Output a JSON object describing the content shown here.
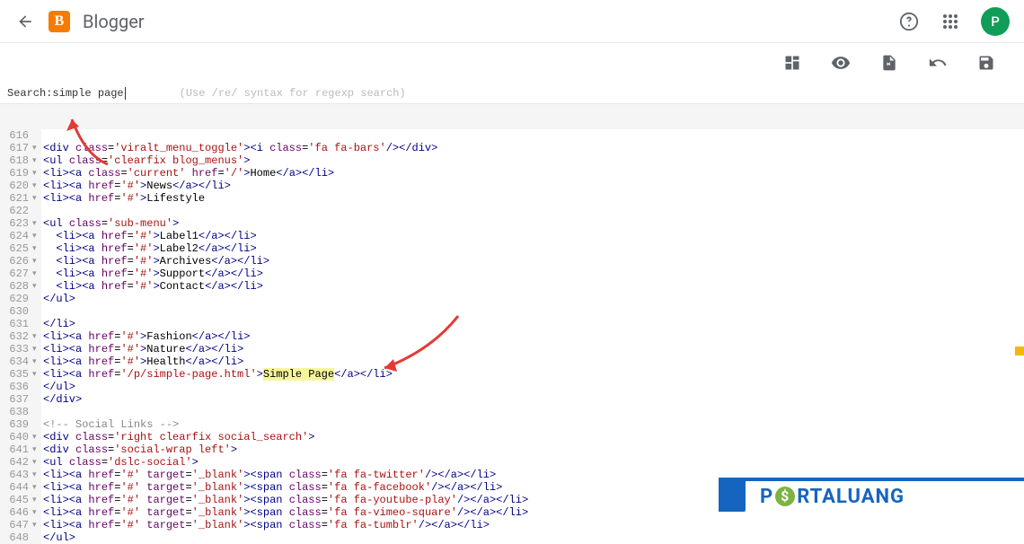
{
  "header": {
    "app_title": "Blogger",
    "logo_letter": "B",
    "avatar_letter": "P"
  },
  "search": {
    "label": "Search: ",
    "value": "simple page",
    "hint": "(Use /re/ syntax for regexp search)"
  },
  "lines": [
    {
      "n": "616",
      "f": "",
      "html": ""
    },
    {
      "n": "617",
      "f": "▾",
      "html": "<span class='t-tag'>&lt;div</span> <span class='t-attr'>class</span>=<span class='t-val'>'viralt_menu_toggle'</span><span class='t-tag'>&gt;&lt;i</span> <span class='t-attr'>class</span>=<span class='t-val'>'fa fa-bars'</span><span class='t-tag'>/&gt;&lt;/div&gt;</span>"
    },
    {
      "n": "618",
      "f": "▾",
      "html": "<span class='t-tag'>&lt;ul</span> <span class='t-attr'>class</span>=<span class='t-val'>'clearfix blog_menus'</span><span class='t-tag'>&gt;</span>"
    },
    {
      "n": "619",
      "f": "▾",
      "html": "<span class='t-tag'>&lt;li&gt;&lt;a</span> <span class='t-attr'>class</span>=<span class='t-val'>'current'</span> <span class='t-attr'>href</span>=<span class='t-val'>'/'</span><span class='t-tag'>&gt;</span><span class='t-text'>Home</span><span class='t-tag'>&lt;/a&gt;&lt;/li&gt;</span>"
    },
    {
      "n": "620",
      "f": "▾",
      "html": "<span class='t-tag'>&lt;li&gt;&lt;a</span> <span class='t-attr'>href</span>=<span class='t-val'>'#'</span><span class='t-tag'>&gt;</span><span class='t-text'>News</span><span class='t-tag'>&lt;/a&gt;&lt;/li&gt;</span>"
    },
    {
      "n": "621",
      "f": "▾",
      "html": "<span class='t-tag'>&lt;li&gt;&lt;a</span> <span class='t-attr'>href</span>=<span class='t-val'>'#'</span><span class='t-tag'>&gt;</span><span class='t-text'>Lifestyle</span>"
    },
    {
      "n": "622",
      "f": "",
      "html": ""
    },
    {
      "n": "623",
      "f": "▾",
      "html": "<span class='t-tag'>&lt;ul</span> <span class='t-attr'>class</span>=<span class='t-val'>'sub-menu'</span><span class='t-tag'>&gt;</span>"
    },
    {
      "n": "624",
      "f": "▾",
      "html": "  <span class='t-tag'>&lt;li&gt;&lt;a</span> <span class='t-attr'>href</span>=<span class='t-val'>'#'</span><span class='t-tag'>&gt;</span><span class='t-text'>Label1</span><span class='t-tag'>&lt;/a&gt;&lt;/li&gt;</span>"
    },
    {
      "n": "625",
      "f": "▾",
      "html": "  <span class='t-tag'>&lt;li&gt;&lt;a</span> <span class='t-attr'>href</span>=<span class='t-val'>'#'</span><span class='t-tag'>&gt;</span><span class='t-text'>Label2</span><span class='t-tag'>&lt;/a&gt;&lt;/li&gt;</span>"
    },
    {
      "n": "626",
      "f": "▾",
      "html": "  <span class='t-tag'>&lt;li&gt;&lt;a</span> <span class='t-attr'>href</span>=<span class='t-val'>'#'</span><span class='t-tag'>&gt;</span><span class='t-text'>Archives</span><span class='t-tag'>&lt;/a&gt;&lt;/li&gt;</span>"
    },
    {
      "n": "627",
      "f": "▾",
      "html": "  <span class='t-tag'>&lt;li&gt;&lt;a</span> <span class='t-attr'>href</span>=<span class='t-val'>'#'</span><span class='t-tag'>&gt;</span><span class='t-text'>Support</span><span class='t-tag'>&lt;/a&gt;&lt;/li&gt;</span>"
    },
    {
      "n": "628",
      "f": "▾",
      "html": "  <span class='t-tag'>&lt;li&gt;&lt;a</span> <span class='t-attr'>href</span>=<span class='t-val'>'#'</span><span class='t-tag'>&gt;</span><span class='t-text'>Contact</span><span class='t-tag'>&lt;/a&gt;&lt;/li&gt;</span>"
    },
    {
      "n": "629",
      "f": "",
      "html": "<span class='t-tag'>&lt;/ul&gt;</span>"
    },
    {
      "n": "630",
      "f": "",
      "html": ""
    },
    {
      "n": "631",
      "f": "",
      "html": "<span class='t-tag'>&lt;/li&gt;</span>"
    },
    {
      "n": "632",
      "f": "▾",
      "html": "<span class='t-tag'>&lt;li&gt;&lt;a</span> <span class='t-attr'>href</span>=<span class='t-val'>'#'</span><span class='t-tag'>&gt;</span><span class='t-text'>Fashion</span><span class='t-tag'>&lt;/a&gt;&lt;/li&gt;</span>"
    },
    {
      "n": "633",
      "f": "▾",
      "html": "<span class='t-tag'>&lt;li&gt;&lt;a</span> <span class='t-attr'>href</span>=<span class='t-val'>'#'</span><span class='t-tag'>&gt;</span><span class='t-text'>Nature</span><span class='t-tag'>&lt;/a&gt;&lt;/li&gt;</span>"
    },
    {
      "n": "634",
      "f": "▾",
      "html": "<span class='t-tag'>&lt;li&gt;&lt;a</span> <span class='t-attr'>href</span>=<span class='t-val'>'#'</span><span class='t-tag'>&gt;</span><span class='t-text'>Health</span><span class='t-tag'>&lt;/a&gt;&lt;/li&gt;</span>"
    },
    {
      "n": "635",
      "f": "▾",
      "html": "<span class='t-tag'>&lt;li&gt;&lt;a</span> <span class='t-attr'>href</span>=<span class='t-val'>'/p/simple-page.html'</span><span class='t-tag'>&gt;</span><span class='hl t-text'>Simple Page</span><span class='t-tag'>&lt;/a&gt;&lt;/li&gt;</span>"
    },
    {
      "n": "636",
      "f": "",
      "html": "<span class='t-tag'>&lt;/ul&gt;</span>"
    },
    {
      "n": "637",
      "f": "",
      "html": "<span class='t-tag'>&lt;/div&gt;</span>"
    },
    {
      "n": "638",
      "f": "",
      "html": ""
    },
    {
      "n": "639",
      "f": "",
      "html": "<span class='t-comment'>&lt;!-- Social Links --&gt;</span>"
    },
    {
      "n": "640",
      "f": "▾",
      "html": "<span class='t-tag'>&lt;div</span> <span class='t-attr'>class</span>=<span class='t-val'>'right clearfix social_search'</span><span class='t-tag'>&gt;</span>"
    },
    {
      "n": "641",
      "f": "▾",
      "html": "<span class='t-tag'>&lt;div</span> <span class='t-attr'>class</span>=<span class='t-val'>'social-wrap left'</span><span class='t-tag'>&gt;</span>"
    },
    {
      "n": "642",
      "f": "▾",
      "html": "<span class='t-tag'>&lt;ul</span> <span class='t-attr'>class</span>=<span class='t-val'>'dslc-social'</span><span class='t-tag'>&gt;</span>"
    },
    {
      "n": "643",
      "f": "▾",
      "html": "<span class='t-tag'>&lt;li&gt;&lt;a</span> <span class='t-attr'>href</span>=<span class='t-val'>'#'</span> <span class='t-attr'>target</span>=<span class='t-val'>'_blank'</span><span class='t-tag'>&gt;&lt;span</span> <span class='t-attr'>class</span>=<span class='t-val'>'fa fa-twitter'</span><span class='t-tag'>/&gt;&lt;/a&gt;&lt;/li&gt;</span>"
    },
    {
      "n": "644",
      "f": "▾",
      "html": "<span class='t-tag'>&lt;li&gt;&lt;a</span> <span class='t-attr'>href</span>=<span class='t-val'>'#'</span> <span class='t-attr'>target</span>=<span class='t-val'>'_blank'</span><span class='t-tag'>&gt;&lt;span</span> <span class='t-attr'>class</span>=<span class='t-val'>'fa fa-facebook'</span><span class='t-tag'>/&gt;&lt;/a&gt;&lt;/li&gt;</span>"
    },
    {
      "n": "645",
      "f": "▾",
      "html": "<span class='t-tag'>&lt;li&gt;&lt;a</span> <span class='t-attr'>href</span>=<span class='t-val'>'#'</span> <span class='t-attr'>target</span>=<span class='t-val'>'_blank'</span><span class='t-tag'>&gt;&lt;span</span> <span class='t-attr'>class</span>=<span class='t-val'>'fa fa-youtube-play'</span><span class='t-tag'>/&gt;&lt;/a&gt;&lt;/li&gt;</span>"
    },
    {
      "n": "646",
      "f": "▾",
      "html": "<span class='t-tag'>&lt;li&gt;&lt;a</span> <span class='t-attr'>href</span>=<span class='t-val'>'#'</span> <span class='t-attr'>target</span>=<span class='t-val'>'_blank'</span><span class='t-tag'>&gt;&lt;span</span> <span class='t-attr'>class</span>=<span class='t-val'>'fa fa-vimeo-square'</span><span class='t-tag'>/&gt;&lt;/a&gt;&lt;/li&gt;</span>"
    },
    {
      "n": "647",
      "f": "▾",
      "html": "<span class='t-tag'>&lt;li&gt;&lt;a</span> <span class='t-attr'>href</span>=<span class='t-val'>'#'</span> <span class='t-attr'>target</span>=<span class='t-val'>'_blank'</span><span class='t-tag'>&gt;&lt;span</span> <span class='t-attr'>class</span>=<span class='t-val'>'fa fa-tumblr'</span><span class='t-tag'>/&gt;&lt;/a&gt;&lt;/li&gt;</span>"
    },
    {
      "n": "648",
      "f": "",
      "html": "<span class='t-tag'>&lt;/ul&gt;</span>"
    }
  ],
  "watermark": {
    "p": "P",
    "o": "$",
    "rest": "RTALUANG"
  }
}
